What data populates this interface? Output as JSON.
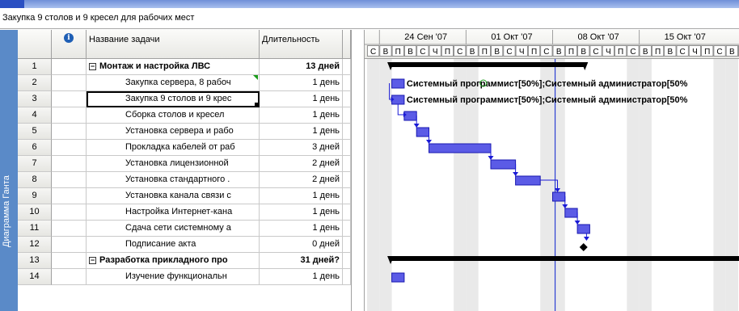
{
  "edit_bar": {
    "text": "Закупка 9 столов и 9 кресел для рабочих мест"
  },
  "sidebar": {
    "label": "Диаграмма Ганта"
  },
  "columns": {
    "info": "i",
    "name": "Название задачи",
    "duration": "Длительность"
  },
  "tasks": [
    {
      "id": "1",
      "name": "Монтаж и настройка ЛВС",
      "duration": "13 дней",
      "summary": true
    },
    {
      "id": "2",
      "name": "Закупка сервера, 8 рабоч",
      "duration": "1 день",
      "summary": false
    },
    {
      "id": "3",
      "name": "Закупка 9 столов и 9 крес",
      "duration": "1 день",
      "summary": false
    },
    {
      "id": "4",
      "name": "Сборка столов и кресел",
      "duration": "1 день",
      "summary": false
    },
    {
      "id": "5",
      "name": "Установка сервера и рабо",
      "duration": "1 день",
      "summary": false
    },
    {
      "id": "6",
      "name": "Прокладка кабелей от раб",
      "duration": "3 дней",
      "summary": false
    },
    {
      "id": "7",
      "name": "Установка лицензионной",
      "duration": "2 дней",
      "summary": false
    },
    {
      "id": "8",
      "name": "Установка стандартного .",
      "duration": "2 дней",
      "summary": false
    },
    {
      "id": "9",
      "name": "Установка канала связи с",
      "duration": "1 день",
      "summary": false
    },
    {
      "id": "10",
      "name": "Настройка Интернет-кана",
      "duration": "1 день",
      "summary": false
    },
    {
      "id": "11",
      "name": "Сдача сети системному а",
      "duration": "1 день",
      "summary": false
    },
    {
      "id": "12",
      "name": "Подписание акта",
      "duration": "0 дней",
      "summary": false
    },
    {
      "id": "13",
      "name": "Разработка прикладного про",
      "duration": "31 дней?",
      "summary": true
    },
    {
      "id": "14",
      "name": "Изучение функциональн",
      "duration": "1 день",
      "summary": false
    }
  ],
  "gantt": {
    "weeks": [
      "24 Сен '07",
      "01 Окт '07",
      "08 Окт '07",
      "15 Окт '07"
    ],
    "day_letters": [
      "С",
      "В",
      "П",
      "В",
      "С",
      "Ч",
      "П",
      "С",
      "В",
      "П",
      "В",
      "С",
      "Ч",
      "П",
      "С",
      "В",
      "П",
      "В",
      "С",
      "Ч",
      "П",
      "С",
      "В",
      "П",
      "В",
      "С",
      "Ч",
      "П",
      "С",
      "В",
      "Т"
    ],
    "resource_labels": [
      "Системный программист[50%];Системный администратор[50%",
      "Системный программист[50%];Системный администратор[50%"
    ],
    "colors": {
      "bar": "#5b5be6",
      "bar_border": "#1a1ab0",
      "summary": "#000000",
      "link": "#1a1ad6",
      "weekend": "#e9e9e9",
      "status_line": "#2c3fd2"
    }
  }
}
